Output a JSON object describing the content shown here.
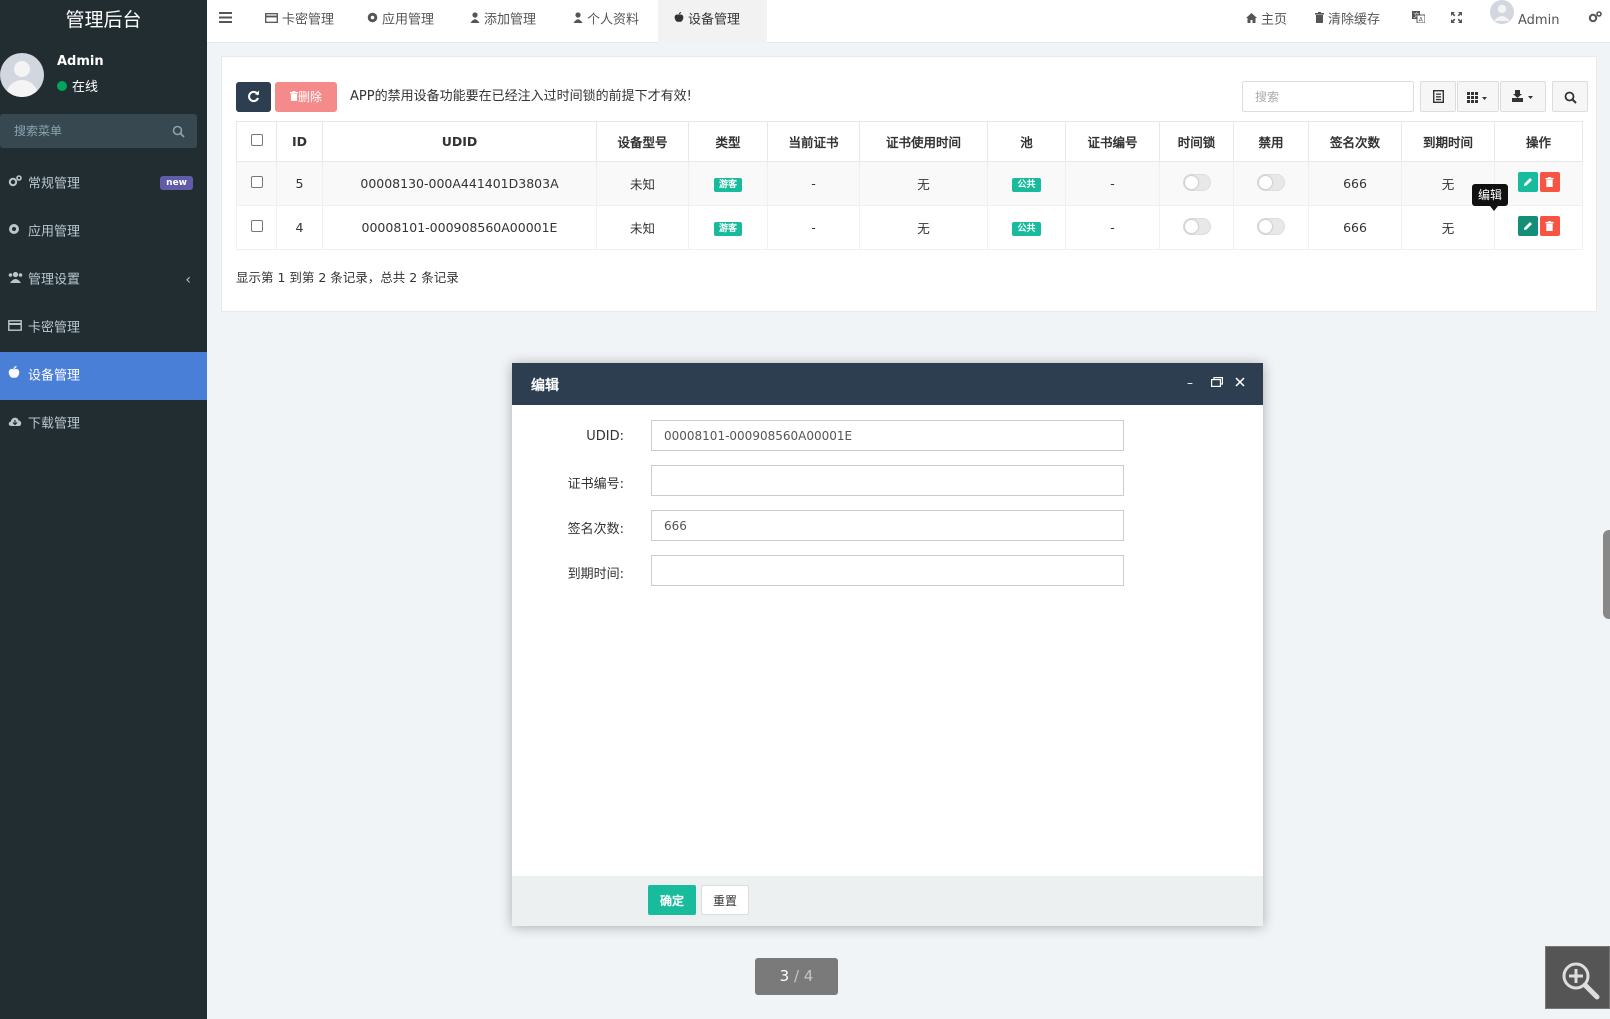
{
  "sidebar": {
    "logo": "管理后台",
    "user_name": "Admin",
    "user_status": "在线",
    "search_placeholder": "搜索菜单",
    "items": [
      {
        "label": "常规管理",
        "icon": "gears-icon",
        "badge": "new"
      },
      {
        "label": "应用管理",
        "icon": "circle-icon"
      },
      {
        "label": "管理设置",
        "icon": "users-icon"
      },
      {
        "label": "卡密管理",
        "icon": "credit-card-icon"
      },
      {
        "label": "设备管理",
        "icon": "apple-icon",
        "active": true
      },
      {
        "label": "下载管理",
        "icon": "cloud-download-icon"
      }
    ]
  },
  "topbar": {
    "tabs": [
      {
        "label": "卡密管理",
        "icon": "credit-card-icon"
      },
      {
        "label": "应用管理",
        "icon": "circle-icon"
      },
      {
        "label": "添加管理",
        "icon": "user-icon"
      },
      {
        "label": "个人资料",
        "icon": "user-icon"
      },
      {
        "label": "设备管理",
        "icon": "apple-icon",
        "active": true
      }
    ],
    "home": "主页",
    "clear_cache": "清除缓存",
    "admin": "Admin"
  },
  "toolbar": {
    "delete_label": "删除",
    "notice": "APP的禁用设备功能要在已经注入过时间锁的前提下才有效!",
    "search_placeholder": "搜索"
  },
  "table": {
    "headers": [
      "ID",
      "UDID",
      "设备型号",
      "类型",
      "当前证书",
      "证书使用时间",
      "池",
      "证书编号",
      "时间锁",
      "禁用",
      "签名次数",
      "到期时间",
      "操作"
    ],
    "rows": [
      {
        "id": "5",
        "udid": "00008130-000A441401D3803A",
        "model": "未知",
        "type": "游客",
        "cert": "-",
        "cert_time": "无",
        "pool": "公共",
        "cert_no": "-",
        "time_lock": false,
        "disabled": false,
        "sign_count": "666",
        "expire": "无"
      },
      {
        "id": "4",
        "udid": "00008101-000908560A00001E",
        "model": "未知",
        "type": "游客",
        "cert": "-",
        "cert_time": "无",
        "pool": "公共",
        "cert_no": "-",
        "time_lock": false,
        "disabled": false,
        "sign_count": "666",
        "expire": "无"
      }
    ],
    "tooltip": "编辑",
    "summary": "显示第 1 到第 2 条记录，总共 2 条记录"
  },
  "modal": {
    "title": "编辑",
    "fields": [
      {
        "label": "UDID:",
        "value": "00008101-000908560A00001E"
      },
      {
        "label": "证书编号:",
        "value": ""
      },
      {
        "label": "签名次数:",
        "value": "666"
      },
      {
        "label": "到期时间:",
        "value": ""
      }
    ],
    "ok": "确定",
    "reset": "重置"
  },
  "pager": {
    "current": "3",
    "sep": " / ",
    "total": "4"
  },
  "colors": {
    "sidebar": "#222d32",
    "active": "#4a7fd8",
    "primary": "#2c3e50",
    "success": "#18bc9c",
    "danger": "#f75444"
  }
}
